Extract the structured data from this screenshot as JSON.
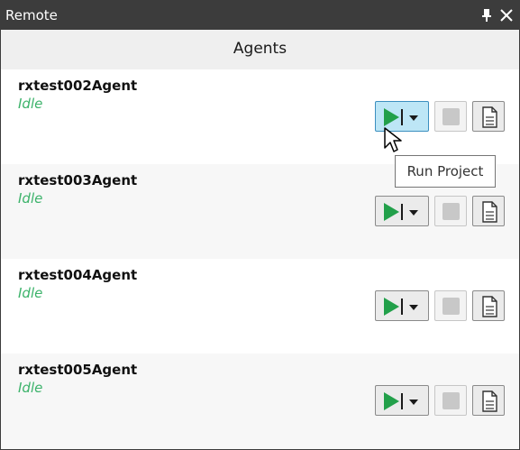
{
  "window": {
    "title": "Remote",
    "pin_icon": "pin-icon",
    "close_icon": "close-icon"
  },
  "header": {
    "title": "Agents"
  },
  "agents": [
    {
      "name": "rxtest002Agent",
      "status": "Idle"
    },
    {
      "name": "rxtest003Agent",
      "status": "Idle"
    },
    {
      "name": "rxtest004Agent",
      "status": "Idle"
    },
    {
      "name": "rxtest005Agent",
      "status": "Idle"
    }
  ],
  "buttons": {
    "run_icon": "play-dropdown-icon",
    "stop_icon": "stop-icon",
    "log_icon": "document-icon"
  },
  "tooltip": {
    "text": "Run Project"
  },
  "colors": {
    "titlebar": "#3c3c3c",
    "status_idle": "#3db36b",
    "play_green": "#22a04a",
    "hover_blue": "#bde6f6"
  }
}
